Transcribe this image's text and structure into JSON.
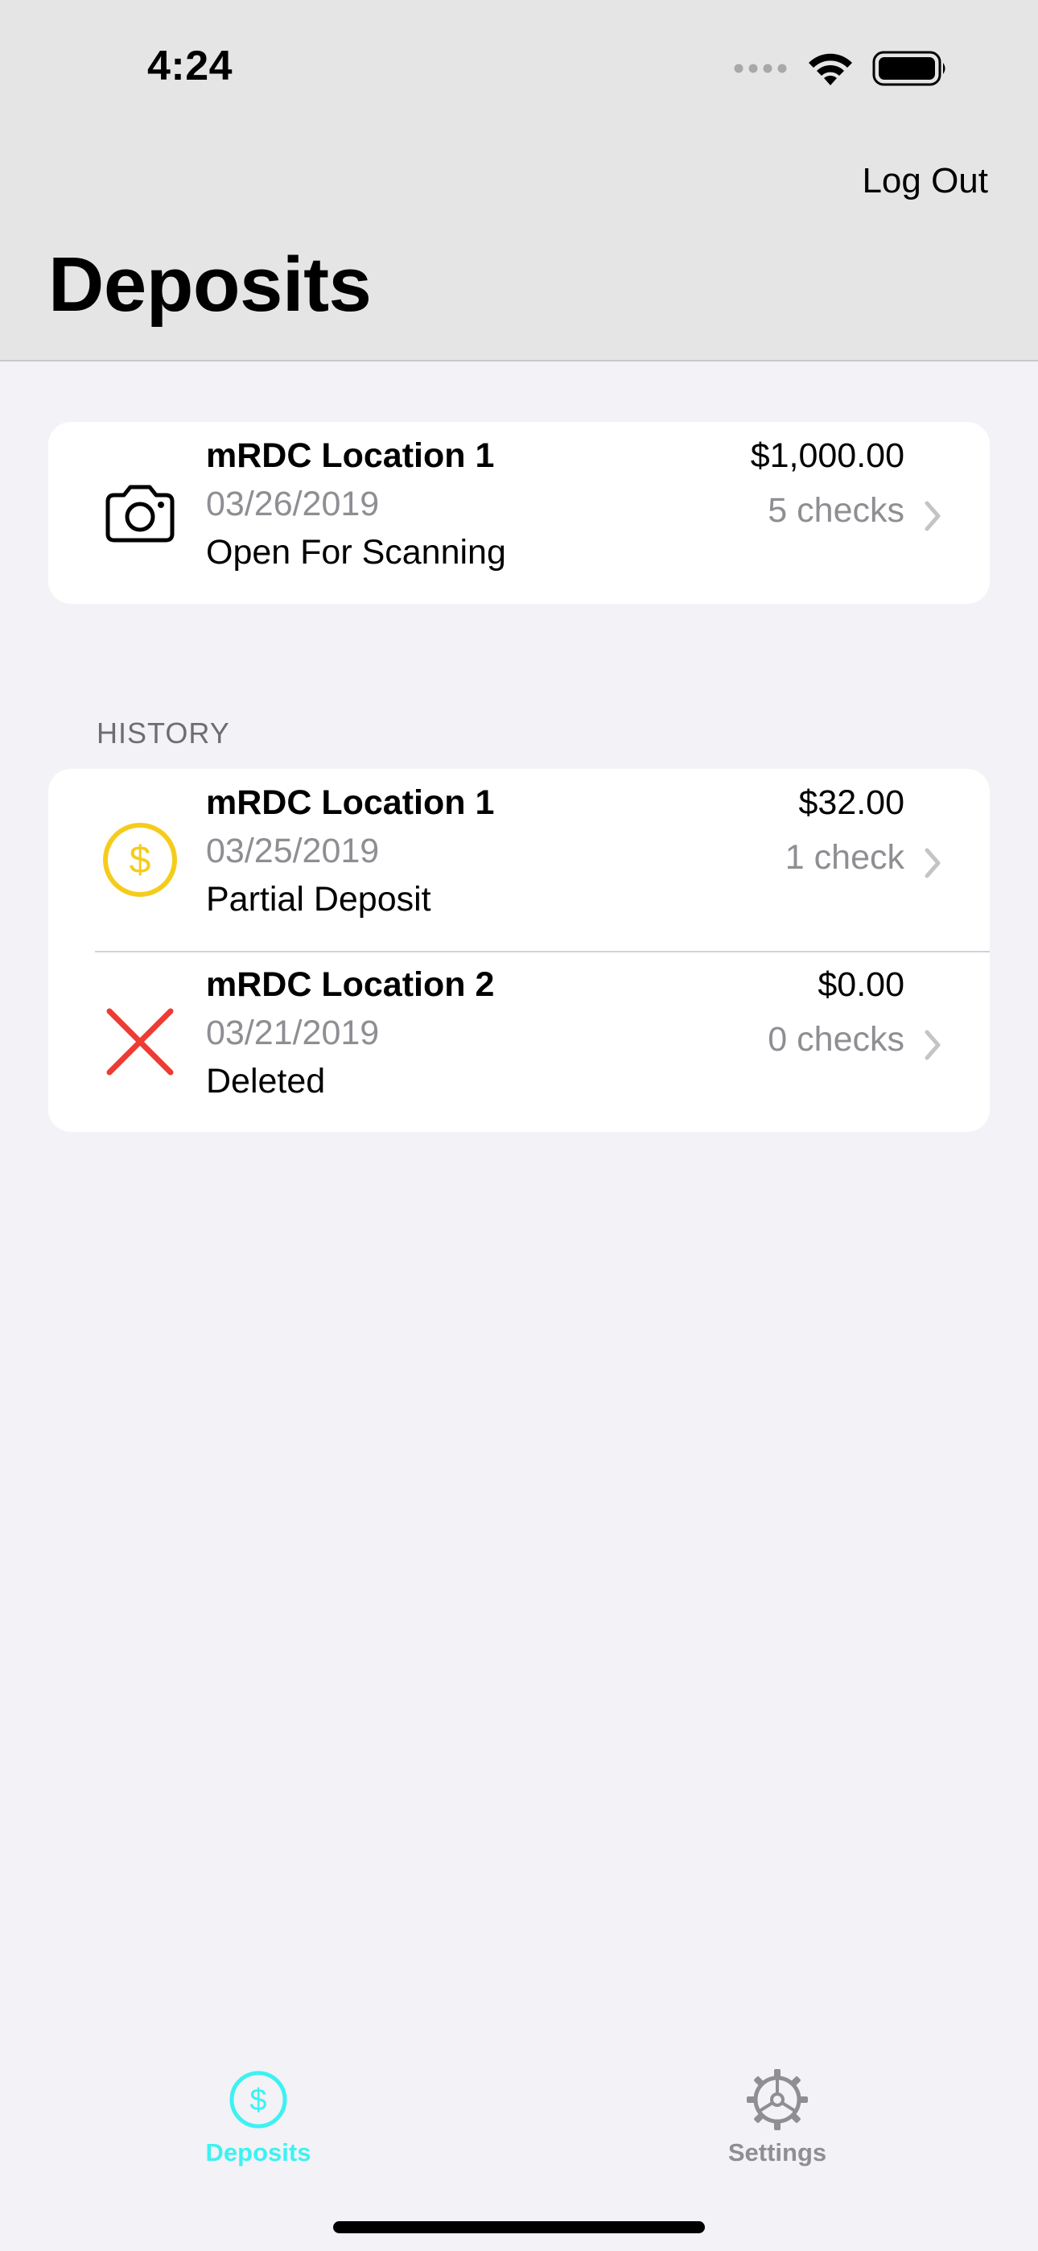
{
  "status_bar": {
    "time": "4:24",
    "icons": [
      "cellular-icon",
      "wifi-icon",
      "battery-icon"
    ]
  },
  "header": {
    "logout_label": "Log Out",
    "title": "Deposits"
  },
  "current_deposit": {
    "icon": "camera-icon",
    "location": "mRDC Location 1",
    "date": "03/26/2019",
    "status": "Open For Scanning",
    "amount": "$1,000.00",
    "checks": "5 checks"
  },
  "history": {
    "header": "HISTORY",
    "items": [
      {
        "icon": "dollar-circle-icon",
        "icon_color": "#f5cc1c",
        "location": "mRDC Location 1",
        "date": "03/25/2019",
        "status": "Partial Deposit",
        "amount": "$32.00",
        "checks": "1 check"
      },
      {
        "icon": "x-mark-icon",
        "icon_color": "#ee3b33",
        "location": "mRDC Location 2",
        "date": "03/21/2019",
        "status": "Deleted",
        "amount": "$0.00",
        "checks": "0 checks"
      }
    ]
  },
  "tab_bar": {
    "tabs": [
      {
        "label": "Deposits",
        "icon": "dollar-circle-icon",
        "selected": true,
        "color": "#3ef1f1"
      },
      {
        "label": "Settings",
        "icon": "gear-icon",
        "selected": false,
        "color": "#8e8e93"
      }
    ]
  },
  "colors": {
    "background": "#f2f2f7",
    "header_background": "#e5e5e5",
    "accent": "#3ef1f1",
    "secondary_text": "#8e8e93"
  }
}
